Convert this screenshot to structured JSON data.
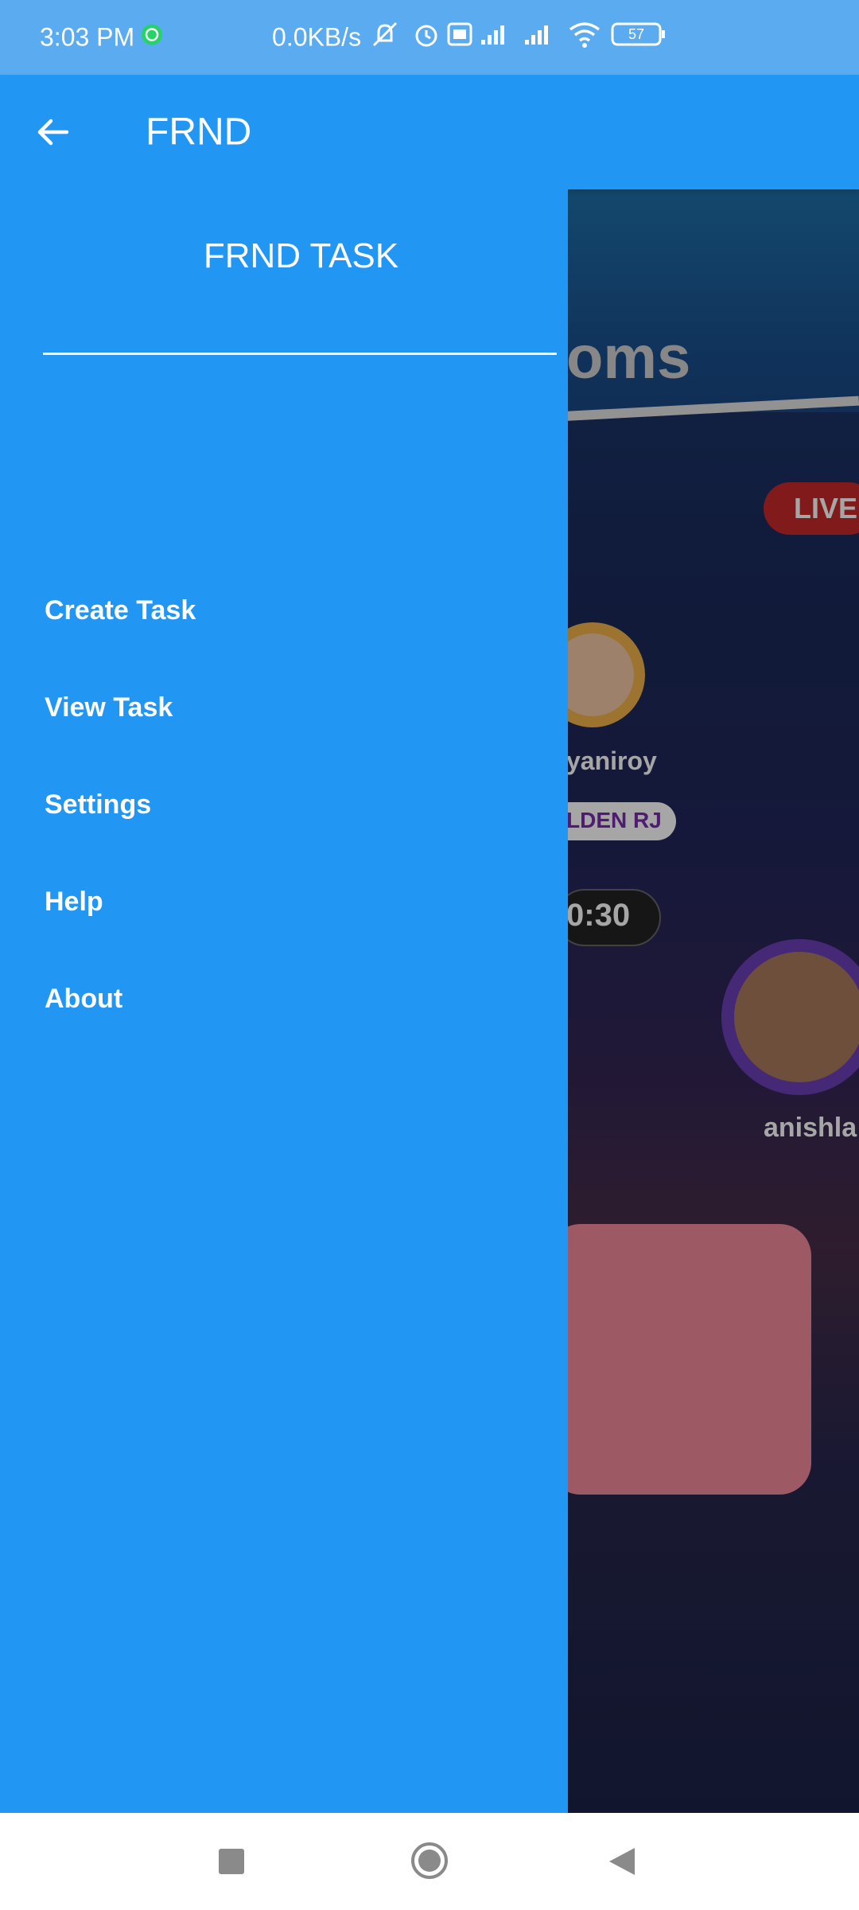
{
  "status_bar": {
    "time": "3:03 PM",
    "net_speed": "0.0KB/s",
    "battery_level": "57",
    "icons": [
      "whatsapp-icon",
      "mute-icon",
      "alarm-icon",
      "volte-icon",
      "signal-icon",
      "signal-icon",
      "wifi-icon",
      "battery-icon"
    ]
  },
  "app_bar": {
    "title": "FRND"
  },
  "drawer": {
    "title": "FRND TASK",
    "items": [
      "Create Task",
      "View Task",
      "Settings",
      "Help",
      "About"
    ]
  },
  "background": {
    "heading_fragment": "oms",
    "live_badge": "LIVE",
    "user_1": "yaniroy",
    "badge_1": "LDEN RJ",
    "timer": "0:30",
    "user_2": "anishla"
  },
  "colors": {
    "primary": "#2196f3",
    "status_bar": "#5aabf0",
    "live_red": "#c62828"
  }
}
